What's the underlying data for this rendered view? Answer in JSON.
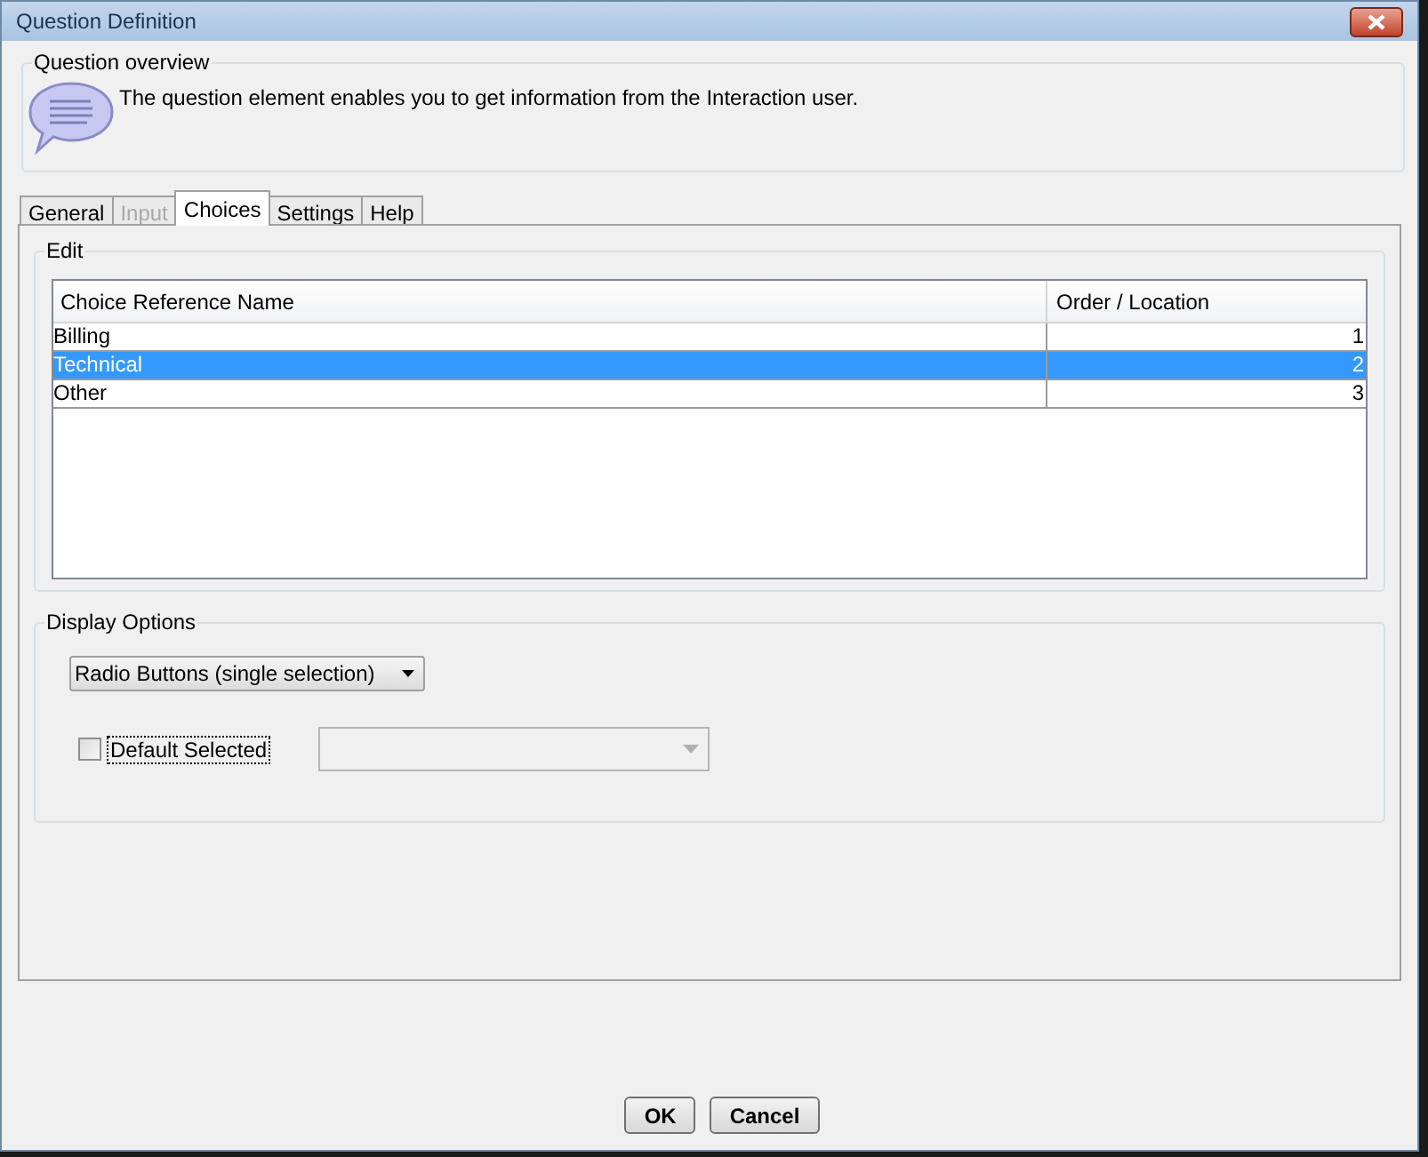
{
  "window": {
    "title": "Question Definition"
  },
  "overview": {
    "legend": "Question overview",
    "text": "The question element enables you to get information from the Interaction user."
  },
  "tabs": [
    {
      "label": "General",
      "selected": false,
      "disabled": false
    },
    {
      "label": "Input",
      "selected": false,
      "disabled": true
    },
    {
      "label": "Choices",
      "selected": true,
      "disabled": false
    },
    {
      "label": "Settings",
      "selected": false,
      "disabled": false
    },
    {
      "label": "Help",
      "selected": false,
      "disabled": false
    }
  ],
  "edit": {
    "legend": "Edit",
    "columns": [
      "Choice Reference Name",
      "Order / Location"
    ],
    "rows": [
      {
        "name": "Billing",
        "order": "1",
        "selected": false
      },
      {
        "name": "Technical",
        "order": "2",
        "selected": true
      },
      {
        "name": "Other",
        "order": "3",
        "selected": false
      }
    ]
  },
  "display_options": {
    "legend": "Display Options",
    "type_value": "Radio Buttons (single selection)",
    "default_selected": {
      "label": "Default Selected",
      "checked": false
    }
  },
  "buttons": [
    "OK",
    "Cancel"
  ]
}
